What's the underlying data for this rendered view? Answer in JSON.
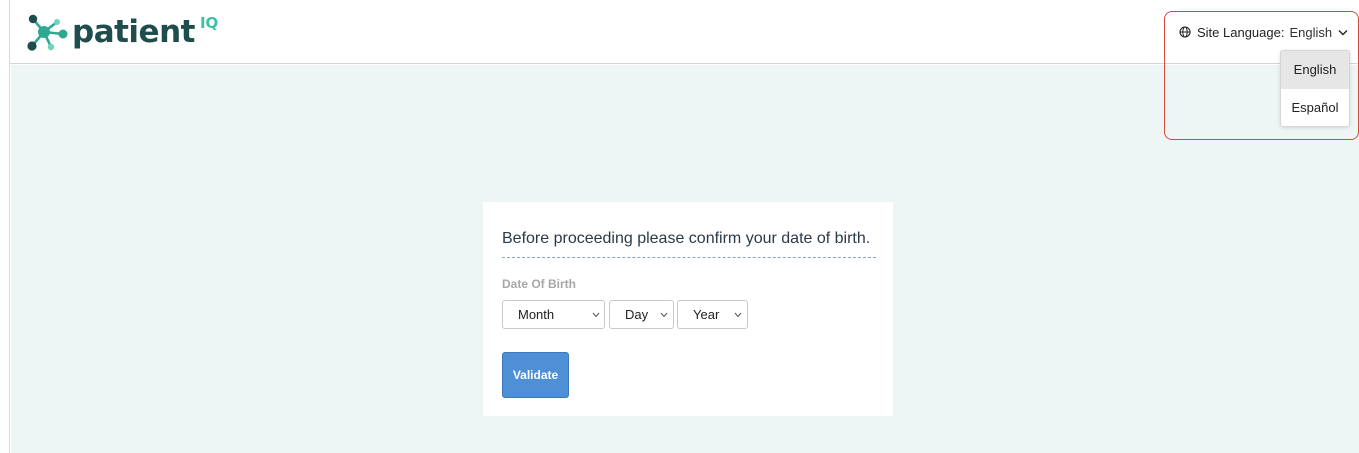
{
  "header": {
    "logo_text": "patient",
    "logo_superscript": "IQ",
    "brand_colors": {
      "dark": "#1f4c4c",
      "accent": "#3cc0a8"
    }
  },
  "language": {
    "label": "Site Language:",
    "current": "English",
    "icon": "globe-icon",
    "options": [
      "English",
      "Español"
    ],
    "selected_index": 0,
    "highlight_color": "#d44c3d"
  },
  "form": {
    "prompt": "Before proceeding please confirm your date of birth.",
    "dob_label": "Date Of Birth",
    "month_placeholder": "Month",
    "day_placeholder": "Day",
    "year_placeholder": "Year",
    "submit_label": "Validate",
    "button_color": "#4f8fd6"
  },
  "colors": {
    "background": "#eef6f5",
    "card": "#ffffff"
  }
}
